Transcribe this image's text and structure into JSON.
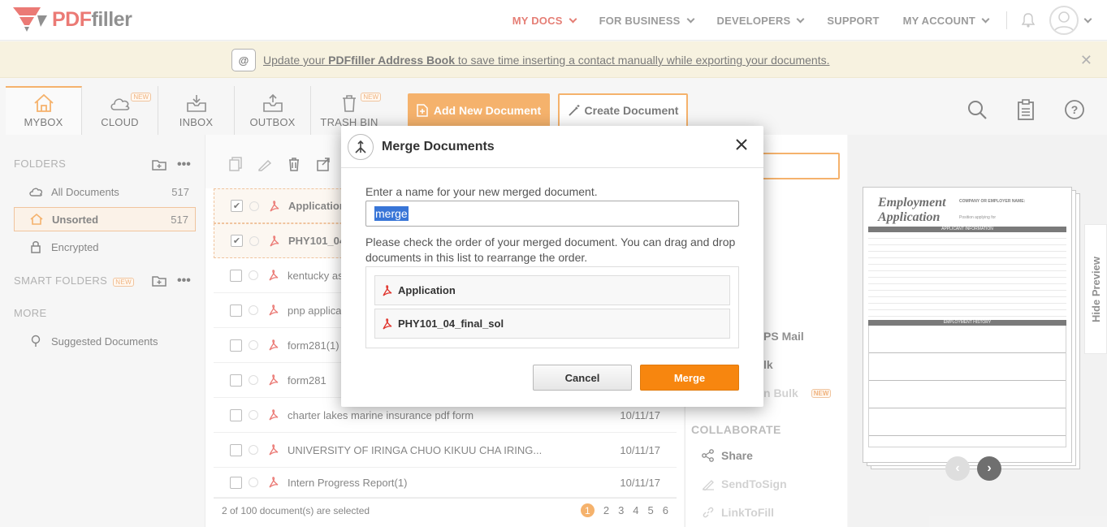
{
  "brand": {
    "name_pdf": "PDF",
    "name_rest": "filler"
  },
  "nav": {
    "items": [
      {
        "label": "MY DOCS",
        "active": true,
        "dropdown": true
      },
      {
        "label": "FOR BUSINESS",
        "dropdown": true
      },
      {
        "label": "DEVELOPERS",
        "dropdown": true
      },
      {
        "label": "SUPPORT",
        "dropdown": false
      },
      {
        "label": "MY ACCOUNT",
        "dropdown": true
      }
    ]
  },
  "notice": {
    "icon_text": "@",
    "text_prefix": "Update your ",
    "text_bold": "PDFfiller Address Book",
    "text_suffix": " to save time inserting a contact manually while exporting your documents."
  },
  "tabs": [
    {
      "label": "MYBOX",
      "icon": "home-icon",
      "active": true
    },
    {
      "label": "CLOUD",
      "icon": "cloud-icon",
      "badge": "NEW"
    },
    {
      "label": "INBOX",
      "icon": "inbox-icon"
    },
    {
      "label": "OUTBOX",
      "icon": "outbox-icon"
    },
    {
      "label": "TRASH BIN",
      "icon": "trash-icon",
      "badge": "NEW"
    }
  ],
  "toolbar": {
    "add_document": "Add New Document",
    "create_document": "Create Document"
  },
  "sidebar": {
    "folders_heading": "FOLDERS",
    "items": [
      {
        "label": "All Documents",
        "count": "517",
        "icon": "cloud-icon"
      },
      {
        "label": "Unsorted",
        "count": "517",
        "icon": "home-icon",
        "active": true
      },
      {
        "label": "Encrypted",
        "count": "",
        "icon": "lock-icon"
      }
    ],
    "smart_heading": "SMART FOLDERS",
    "smart_badge": "NEW",
    "more_heading": "MORE",
    "more_items": [
      {
        "label": "Suggested Documents",
        "icon": "lightbulb-icon"
      }
    ]
  },
  "documents": {
    "rows": [
      {
        "name": "Application",
        "date": "",
        "selected": true
      },
      {
        "name": "PHY101_04",
        "date": "",
        "selected": true
      },
      {
        "name": "kentucky as",
        "date": "",
        "selected": false
      },
      {
        "name": "pnp applicat",
        "date": "",
        "selected": false
      },
      {
        "name": "form281(1)",
        "date": "",
        "selected": false
      },
      {
        "name": "form281",
        "date": "",
        "selected": false
      },
      {
        "name": "charter lakes marine insurance pdf form",
        "date": "10/11/17",
        "selected": false
      },
      {
        "name": "UNIVERSITY OF IRINGA CHUO KIKUU CHA IRING...",
        "date": "10/11/17",
        "selected": false
      },
      {
        "name": "Intern Progress Report(1)",
        "date": "10/11/17",
        "selected": false
      }
    ],
    "selection_status": "2 of 100 document(s) are selected",
    "pages": [
      "1",
      "2",
      "3",
      "4",
      "5",
      "6"
    ],
    "current_page": "1"
  },
  "actions_panel": {
    "partial_items": [
      {
        "label": "PS Mail"
      },
      {
        "label": "lk"
      },
      {
        "label": "n Bulk",
        "badge": "NEW",
        "dim": true
      }
    ],
    "collaborate_heading": "COLLABORATE",
    "collaborate_items": [
      {
        "label": "Share",
        "icon": "share-icon",
        "dim": false
      },
      {
        "label": "SendToSign",
        "icon": "pen-icon",
        "dim": true
      },
      {
        "label": "LinkToFill",
        "icon": "link-icon",
        "dim": true
      }
    ]
  },
  "preview": {
    "hide_label": "Hide Preview",
    "doc_title_line1": "Employment",
    "doc_title_line2": "Application",
    "doc_company_label": "COMPANY OR EMPLOYER NAME:",
    "doc_position_label": "Position applying for",
    "doc_section_applicant": "APPLICANT INFORMATION",
    "doc_section_history": "EMPLOYMENT HISTORY"
  },
  "modal": {
    "title": "Merge Documents",
    "name_label": "Enter a name for your new merged document.",
    "name_value": "merge",
    "order_label": "Please check the order of your merged document. You can drag and drop documents in this list to rearrange the order.",
    "items": [
      "Application",
      "PHY101_04_final_sol"
    ],
    "cancel_label": "Cancel",
    "merge_label": "Merge"
  },
  "colors": {
    "accent": "#f0891e",
    "brand_red": "#d8392b",
    "merge_button": "#f7860f"
  }
}
